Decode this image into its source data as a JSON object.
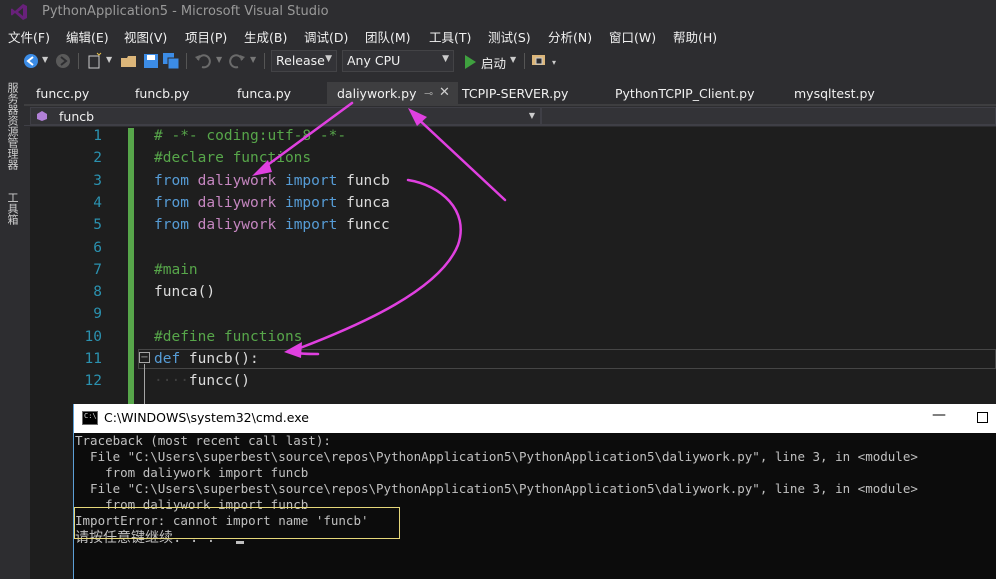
{
  "window": {
    "title": "PythonApplication5 - Microsoft Visual Studio"
  },
  "menu": [
    "文件(F)",
    "编辑(E)",
    "视图(V)",
    "项目(P)",
    "生成(B)",
    "调试(D)",
    "团队(M)",
    "工具(T)",
    "测试(S)",
    "分析(N)",
    "窗口(W)",
    "帮助(H)"
  ],
  "toolbar": {
    "configuration": "Release",
    "platform": "Any CPU",
    "start_label": "启动"
  },
  "side_panel": {
    "server_explorer": "服务器资源管理器",
    "toolbox": "工具箱"
  },
  "tabs": [
    {
      "label": "funcc.py",
      "active": false
    },
    {
      "label": "funcb.py",
      "active": false
    },
    {
      "label": "funca.py",
      "active": false
    },
    {
      "label": "daliywork.py",
      "active": true
    },
    {
      "label": "TCPIP-SERVER.py",
      "active": false
    },
    {
      "label": "PythonTCPIP_Client.py",
      "active": false
    },
    {
      "label": "mysqltest.py",
      "active": false
    }
  ],
  "navigation": {
    "scope": "funcb"
  },
  "editor": {
    "line_numbers": [
      "1",
      "2",
      "3",
      "4",
      "5",
      "6",
      "7",
      "8",
      "9",
      "10",
      "11",
      "12"
    ],
    "lines": [
      {
        "parts": [
          [
            "cmt",
            "# -*- coding:utf-8 -*-"
          ]
        ]
      },
      {
        "parts": [
          [
            "cmt",
            "#declare functions"
          ]
        ]
      },
      {
        "parts": [
          [
            "kw",
            "from"
          ],
          [
            "sp",
            " "
          ],
          [
            "mod",
            "daliywork"
          ],
          [
            "sp",
            " "
          ],
          [
            "kw",
            "import"
          ],
          [
            "txt",
            " funcb"
          ]
        ]
      },
      {
        "parts": [
          [
            "kw",
            "from"
          ],
          [
            "sp",
            " "
          ],
          [
            "mod",
            "daliywork"
          ],
          [
            "sp",
            " "
          ],
          [
            "kw",
            "import"
          ],
          [
            "txt",
            " funca"
          ]
        ]
      },
      {
        "parts": [
          [
            "kw",
            "from"
          ],
          [
            "sp",
            " "
          ],
          [
            "mod",
            "daliywork"
          ],
          [
            "sp",
            " "
          ],
          [
            "kw",
            "import"
          ],
          [
            "txt",
            " funcc"
          ]
        ]
      },
      {
        "parts": []
      },
      {
        "parts": [
          [
            "cmt",
            "#main"
          ]
        ]
      },
      {
        "parts": [
          [
            "txt",
            "funca()"
          ]
        ]
      },
      {
        "parts": []
      },
      {
        "parts": [
          [
            "cmt",
            "#define functions"
          ]
        ]
      },
      {
        "parts": [
          [
            "kw",
            "def"
          ],
          [
            "txt",
            " funcb():"
          ]
        ]
      },
      {
        "parts": [
          [
            "dots",
            "····"
          ],
          [
            "txt",
            "funcc()"
          ]
        ]
      }
    ]
  },
  "cmd": {
    "title": "C:\\WINDOWS\\system32\\cmd.exe",
    "lines": [
      "Traceback (most recent call last):",
      "  File \"C:\\Users\\superbest\\source\\repos\\PythonApplication5\\PythonApplication5\\daliywork.py\", line 3, in <module>",
      "    from daliywork import funcb",
      "  File \"C:\\Users\\superbest\\source\\repos\\PythonApplication5\\PythonApplication5\\daliywork.py\", line 3, in <module>",
      "    from daliywork import funcb",
      "ImportError: cannot import name 'funcb'",
      "请按任意键继续. . ."
    ]
  },
  "colors": {
    "accent": "#007acc",
    "annotation": "#e040e0",
    "comment": "#57a64a",
    "keyword": "#569cd6",
    "module": "#c586c0"
  }
}
